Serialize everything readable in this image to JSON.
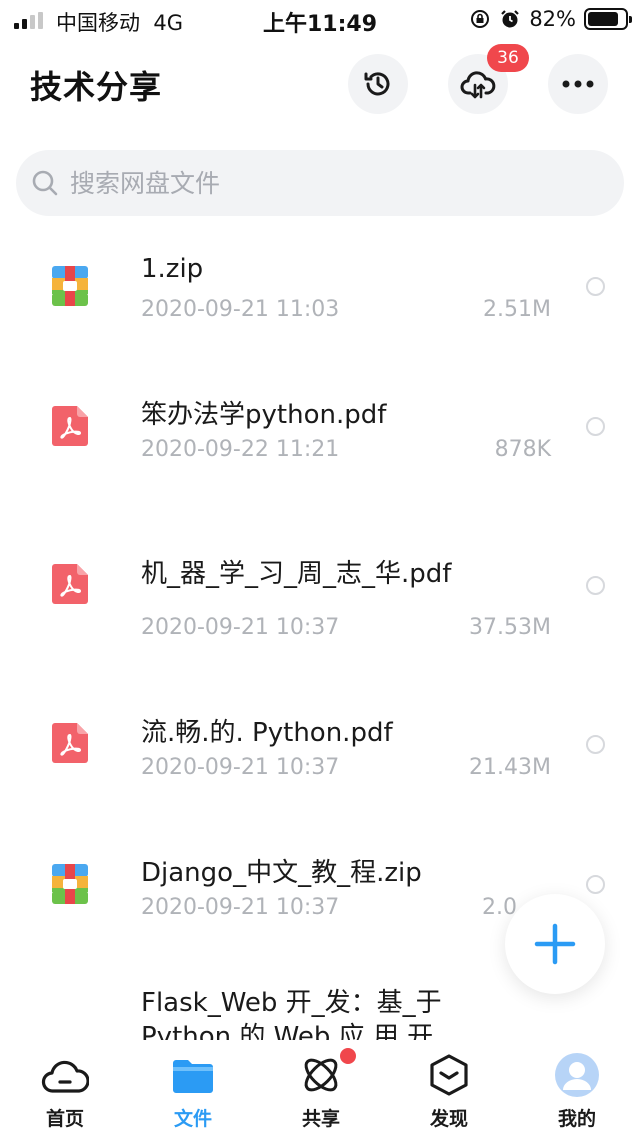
{
  "status_bar": {
    "carrier": "中国移动",
    "network": "4G",
    "time": "上午11:49",
    "battery": "82%",
    "battery_level": 0.82
  },
  "header": {
    "title": "技术分享",
    "upload_badge": "36"
  },
  "search": {
    "placeholder": "搜索网盘文件"
  },
  "files": [
    {
      "name": "1.zip",
      "date": "2020-09-21 11:03",
      "size": "2.51M",
      "icon": "zip-archive-icon"
    },
    {
      "name": "笨办法学python.pdf",
      "date": "2020-09-22 11:21",
      "size": "878K",
      "icon": "pdf-icon"
    },
    {
      "name": "机_器_学_习_周_志_华.pdf",
      "date": "2020-09-21 10:37",
      "size": "37.53M",
      "icon": "pdf-icon"
    },
    {
      "name": "流.畅.的. Python.pdf",
      "date": "2020-09-21 10:37",
      "size": "21.43M",
      "icon": "pdf-icon"
    },
    {
      "name": "Django_中文_教_程.zip",
      "date": "2020-09-21 10:37",
      "size": "2.0",
      "icon": "zip-archive-icon"
    },
    {
      "name": "Flask_Web 开_发：基_于 Python 的 Web 应 用 开",
      "icon": "pdf-icon"
    }
  ],
  "tabs": [
    {
      "label": "首页",
      "icon": "home-cloud-icon"
    },
    {
      "label": "文件",
      "icon": "folder-icon",
      "active": true
    },
    {
      "label": "共享",
      "icon": "share-atom-icon"
    },
    {
      "label": "发现",
      "icon": "discover-box-icon"
    },
    {
      "label": "我的",
      "icon": "avatar-icon"
    }
  ],
  "colors": {
    "accent": "#2b9bf4",
    "badge": "#f0474c",
    "pdf": "#f2626a",
    "secondary_text": "#b0b3b8"
  }
}
